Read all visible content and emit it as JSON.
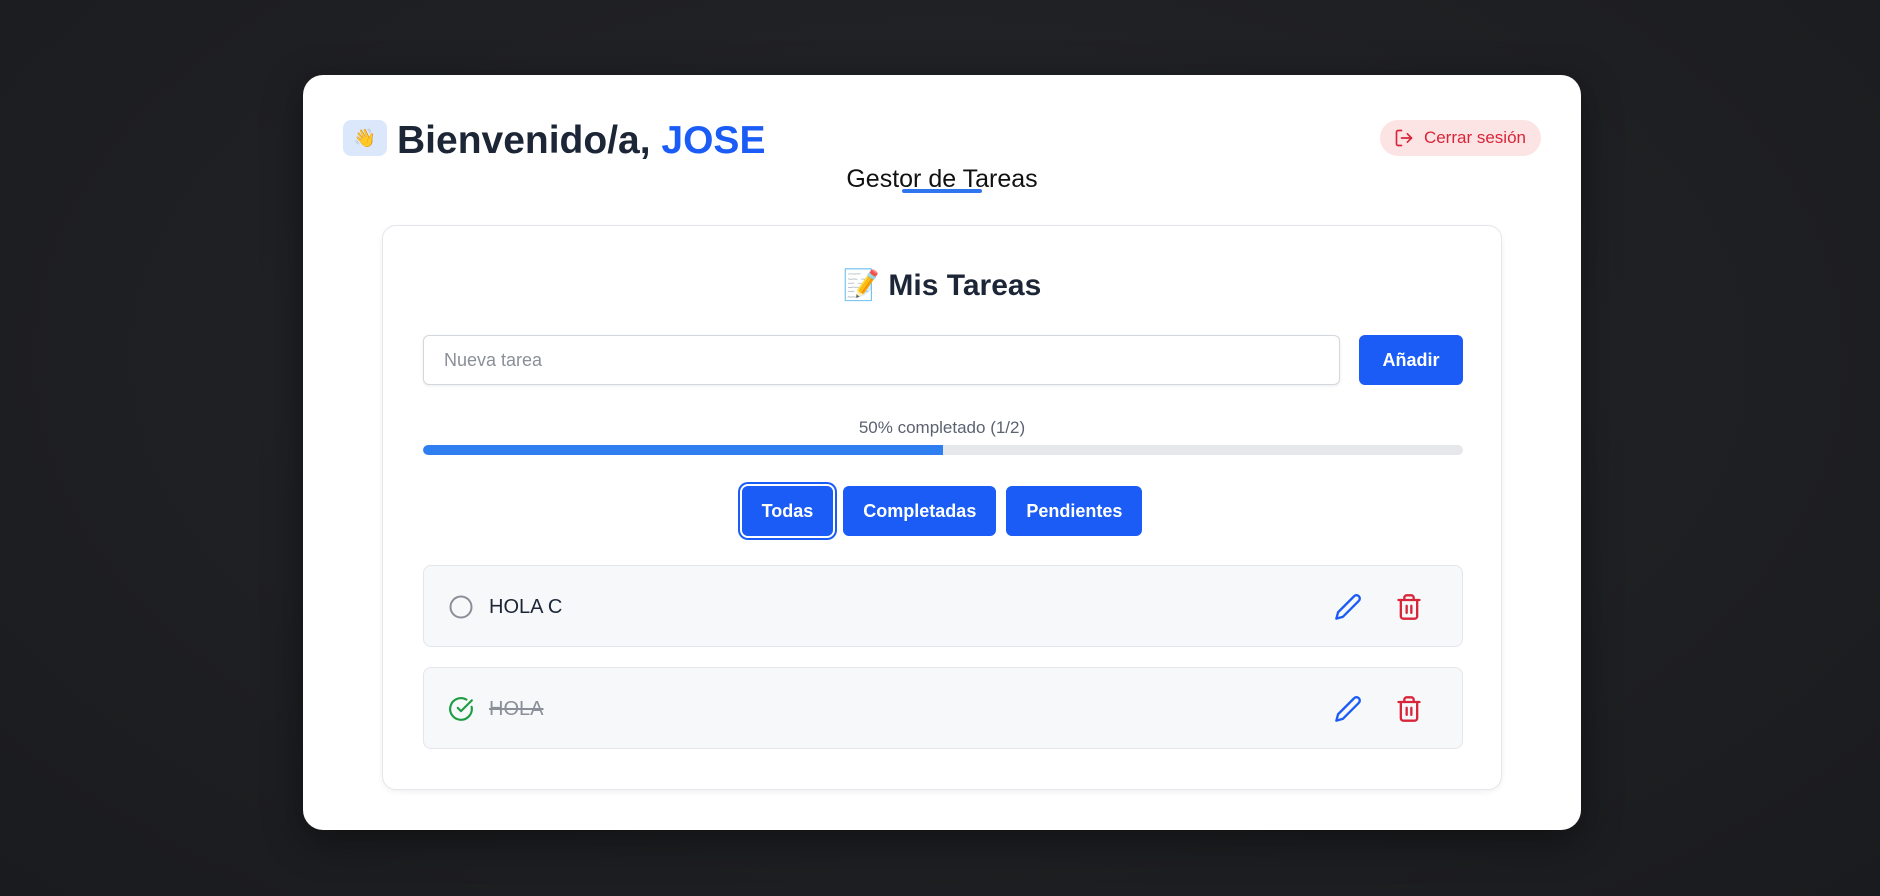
{
  "header": {
    "welcome_prefix": "Bienvenido/a,",
    "user_name": "JOSE",
    "wave_emoji": "👋",
    "logout_label": "Cerrar sesión",
    "logout_icon": "logout-icon",
    "subtitle": "Gestor de Tareas"
  },
  "tasks_panel": {
    "title_emoji": "📝",
    "title": "Mis Tareas",
    "input_placeholder": "Nueva tarea",
    "input_value": "",
    "add_label": "Añadir",
    "progress_text": "50% completado (1/2)",
    "progress_fraction": 0.5
  },
  "filters": {
    "all": "Todas",
    "completed": "Completadas",
    "pending": "Pendientes",
    "active": "Todas"
  },
  "tasks": [
    {
      "text": "HOLA C",
      "completed": false
    },
    {
      "text": "HOLA",
      "completed": true
    }
  ],
  "colors": {
    "primary": "#1a5cf5",
    "danger": "#d8253a",
    "success": "#1f9d44",
    "background": "#1f2023"
  }
}
